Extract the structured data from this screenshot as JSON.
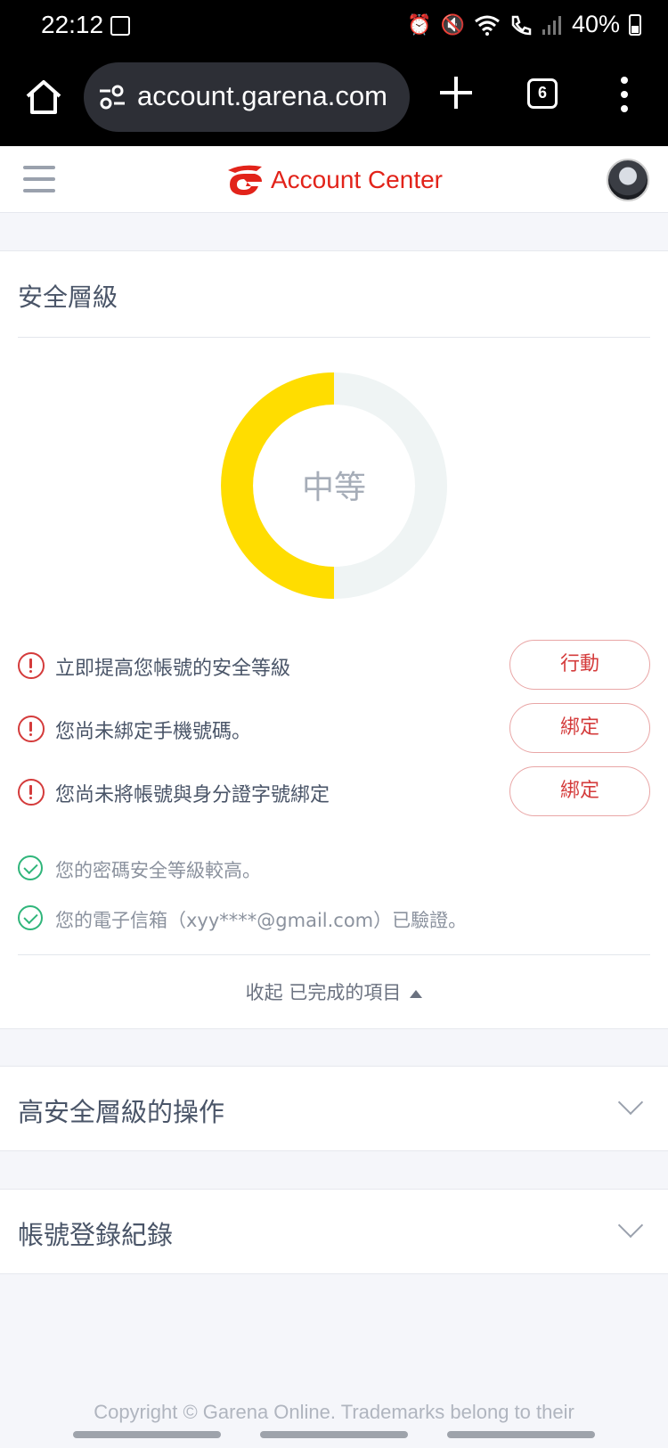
{
  "status_bar": {
    "time": "22:12",
    "battery": "40%",
    "icons": [
      "image-icon",
      "alarm-icon",
      "mute-icon",
      "wifi-icon",
      "wifi-calling-icon",
      "signal-icon",
      "battery-icon"
    ]
  },
  "browser": {
    "url": "account.garena.com",
    "tab_count": "6",
    "icons": [
      "home-icon",
      "site-settings-icon",
      "new-tab-icon",
      "tabs-icon",
      "more-vert-icon"
    ]
  },
  "header": {
    "title": "Account Center",
    "brand_color": "#e2231a"
  },
  "security": {
    "title": "安全層級",
    "level_label": "中等",
    "level_progress": 0.5,
    "level_color": "#ffdd00",
    "todo_items": [
      {
        "text": "立即提高您帳號的安全等級",
        "button": "行動"
      },
      {
        "text": "您尚未綁定手機號碼。",
        "button": "綁定"
      },
      {
        "text": "您尚未將帳號與身分證字號綁定",
        "button": "綁定"
      }
    ],
    "done_items": [
      {
        "text": "您的密碼安全等級較高。"
      },
      {
        "text": "您的電子信箱（xyy****@gmail.com）已驗證。"
      }
    ],
    "collapse_label": "收起 已完成的項目"
  },
  "sections": [
    {
      "title": "高安全層級的操作"
    },
    {
      "title": "帳號登錄紀錄"
    }
  ],
  "footer": {
    "text": "Copyright © Garena Online. Trademarks belong to their"
  }
}
